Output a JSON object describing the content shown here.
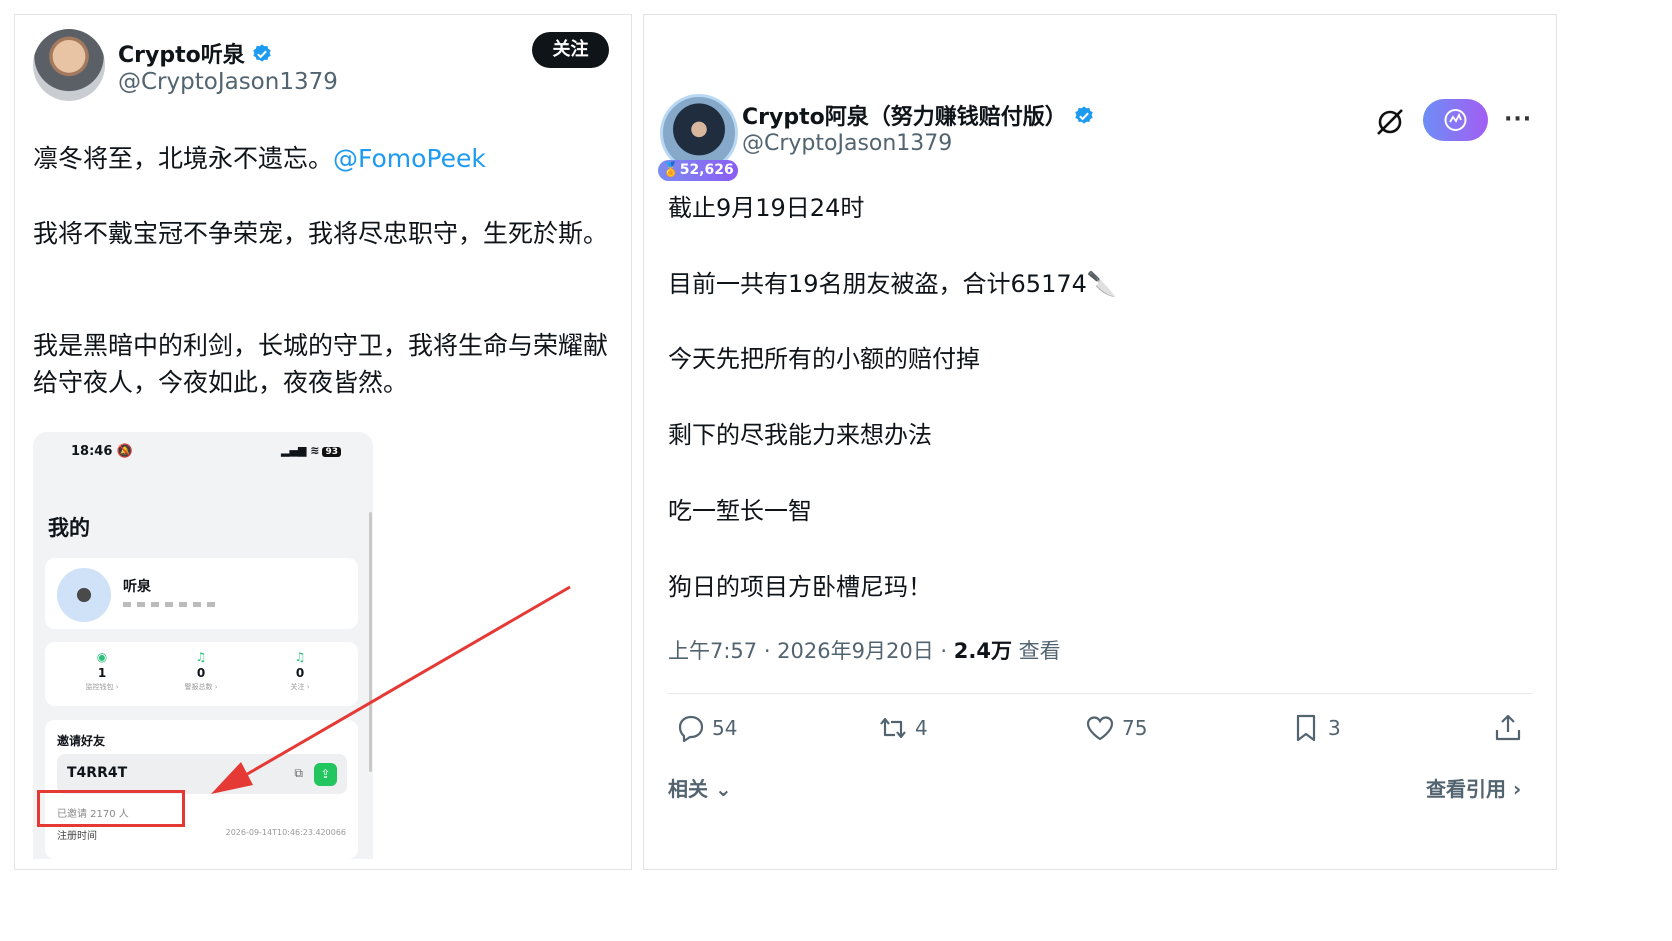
{
  "left_post": {
    "display_name": "Crypto听泉",
    "handle": "@CryptoJason1379",
    "follow_label": "关注",
    "line1": "凛冬将至，北境永不遗忘。",
    "mention": "@FomoPeek",
    "para2": "我将不戴宝冠不争荣宠，我将尽忠职守，生死於斯。",
    "para3": "我是黑暗中的利剑，长城的守卫，我将生命与荣耀献给守夜人，今夜如此，夜夜皆然。",
    "phone": {
      "time": "18:46",
      "battery": "93",
      "title": "我的",
      "user_name": "听泉",
      "stats": [
        {
          "icon": "eye-icon",
          "value": "1",
          "label": "监控钱包 ›"
        },
        {
          "icon": "bell-icon",
          "value": "0",
          "label": "警报总数 ›"
        },
        {
          "icon": "bell-check-icon",
          "value": "0",
          "label": "关注 ›"
        }
      ],
      "invite_title": "邀请好友",
      "invite_code": "T4RR4T",
      "invited_count": "已邀请 2170 人",
      "register_label": "注册时间",
      "register_time": "2026-09-14T10:46:23.420066"
    }
  },
  "right_post": {
    "display_name": "Crypto阿泉（努力赚钱赔付版）",
    "handle": "@CryptoJason1379",
    "badge_count": "52,626",
    "lines": [
      "截止9月19日24时",
      "目前一共有19名朋友被盗，合计65174🔪",
      "今天先把所有的小额的赔付掉",
      "剩下的尽我能力来想办法",
      "吃一堑长一智",
      "狗日的项目方卧槽尼玛！"
    ],
    "meta_time": "上午7:57 · 2026年9月20日 · ",
    "meta_views": "2.4万",
    "meta_views_label": " 查看",
    "replies": "54",
    "reposts": "4",
    "likes": "75",
    "bookmarks": "3",
    "related_label": "相关",
    "quotes_label": "查看引用"
  },
  "colors": {
    "accent": "#1d9bf0",
    "red_highlight": "#e53935",
    "grok_gradient_start": "#6d8df6",
    "grok_gradient_end": "#a35ef3"
  }
}
